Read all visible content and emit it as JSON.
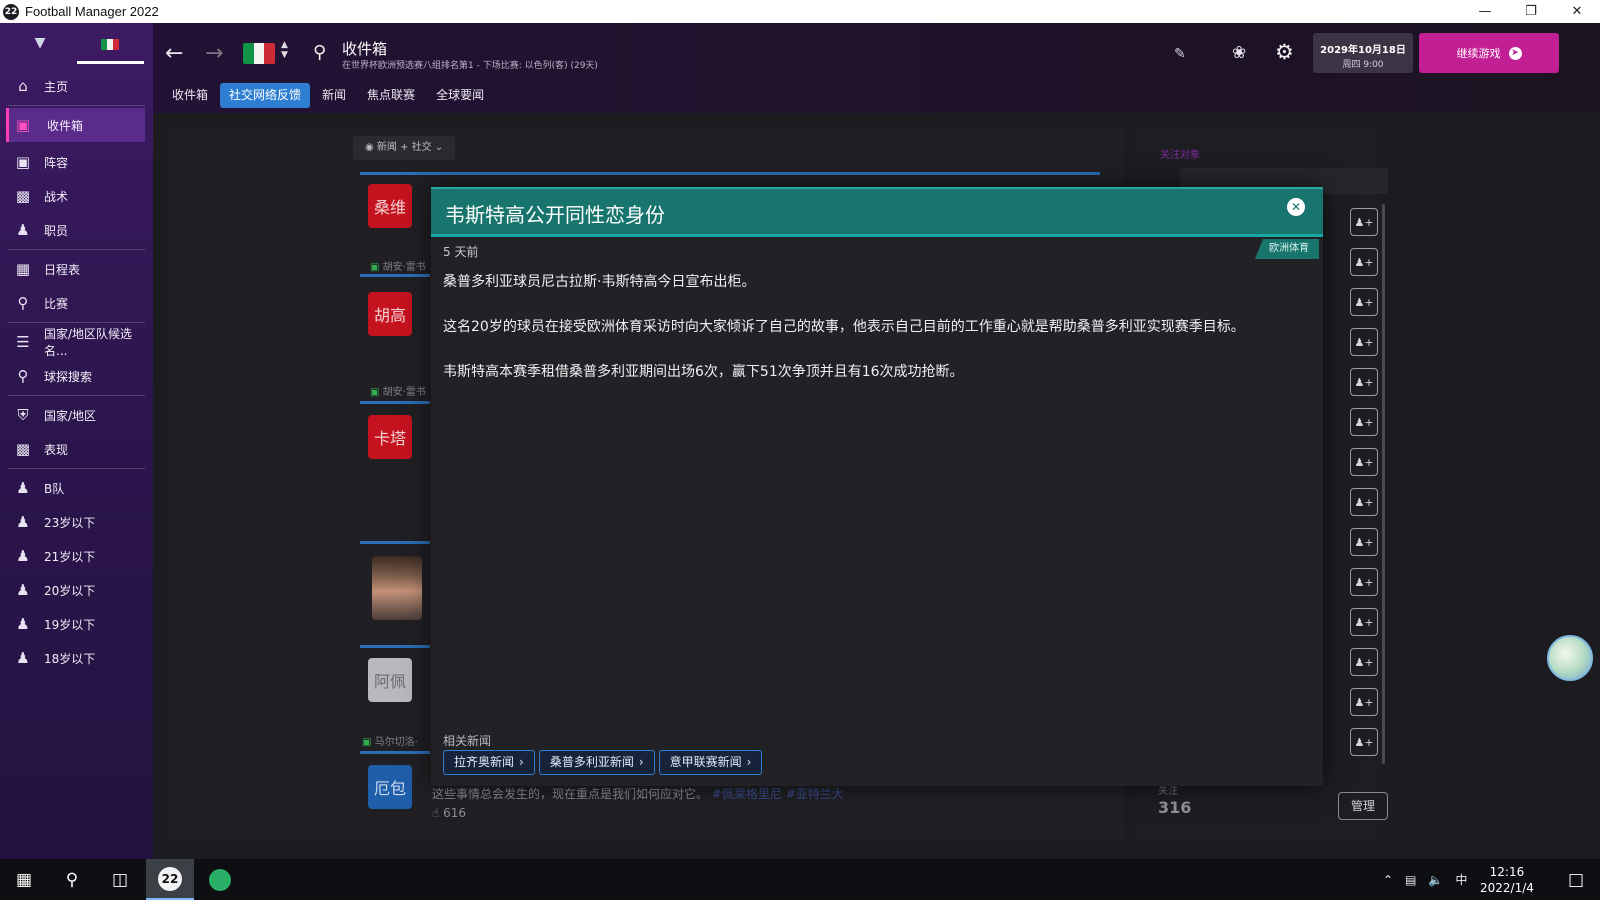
{
  "window": {
    "title": "Football Manager 2022",
    "app_icon": "22",
    "controls": [
      "minimize-icon",
      "restore-icon",
      "close-icon"
    ]
  },
  "colors": {
    "sidebar": "#3d1b63",
    "accent": "#c21f94",
    "tab_active": "#2e7fd1",
    "modal_header": "#17756d"
  },
  "sidebar": {
    "items": [
      {
        "label": "主页",
        "icon": "home-icon"
      },
      {
        "label": "收件箱",
        "icon": "inbox-icon",
        "active": true
      },
      {
        "label": "阵容",
        "icon": "squad-shirt-icon"
      },
      {
        "label": "战术",
        "icon": "tactics-board-icon"
      },
      {
        "label": "职员",
        "icon": "staff-icon"
      },
      {
        "label": "日程表",
        "icon": "calendar-icon"
      },
      {
        "label": "比赛",
        "icon": "trophy-icon"
      },
      {
        "label": "国家/地区队候选名...",
        "icon": "list-icon"
      },
      {
        "label": "球探搜索",
        "icon": "search-icon"
      },
      {
        "label": "国家/地区",
        "icon": "shield-icon"
      },
      {
        "label": "表现",
        "icon": "briefcase-icon"
      },
      {
        "label": "B队",
        "icon": "team-icon"
      },
      {
        "label": "23岁以下",
        "icon": "team-icon"
      },
      {
        "label": "21岁以下",
        "icon": "team-icon"
      },
      {
        "label": "20岁以下",
        "icon": "team-icon"
      },
      {
        "label": "19岁以下",
        "icon": "team-icon"
      },
      {
        "label": "18岁以下",
        "icon": "team-icon"
      }
    ]
  },
  "header": {
    "page_title": "收件箱",
    "subtitle": "在世界杯欧洲预选赛八组排名第1 - 下场比赛: 以色列(客) (29天)",
    "date_line1": "2029年10月18日",
    "date_line2": "周四 9:00",
    "continue_label": "继续游戏",
    "tabs": [
      {
        "label": "收件箱"
      },
      {
        "label": "社交网络反馈",
        "active": true
      },
      {
        "label": "新闻"
      },
      {
        "label": "焦点联赛"
      },
      {
        "label": "全球要闻"
      }
    ]
  },
  "feed": {
    "filter_label": "新闻 + 社交",
    "cards": [
      {
        "badge": "桑维",
        "author": "胡安·雷书"
      },
      {
        "badge": "胡高",
        "author": "胡安·雷书"
      },
      {
        "badge": "卡塔",
        "author": ""
      },
      {
        "badge": "阿佩",
        "author": "马尔切洛·"
      },
      {
        "badge": "厄包",
        "author": ""
      }
    ],
    "post_text": "这些事情总会发生的，现在重点是我们如何应对它。",
    "post_hashtags": "#佩莱格里尼 #亚特兰大",
    "post_likes": "616"
  },
  "follow": {
    "title": "关注对象",
    "search_placeholder": "",
    "count_label": "关注",
    "count": "316",
    "manage_label": "管理"
  },
  "modal": {
    "title": "韦斯特高公开同性恋身份",
    "time": "5 天前",
    "source": "欧洲体育",
    "paragraphs": [
      "桑普多利亚球员尼古拉斯·韦斯特高今日宣布出柜。",
      "这名20岁的球员在接受欧洲体育采访时向大家倾诉了自己的故事，他表示自己目前的工作重心就是帮助桑普多利亚实现赛季目标。",
      "韦斯特高本赛季租借桑普多利亚期间出场6次，赢下51次争顶并且有16次成功抢断。"
    ],
    "related_label": "相关新闻",
    "related": [
      "拉齐奥新闻",
      "桑普多利亚新闻",
      "意甲联赛新闻"
    ]
  },
  "taskbar": {
    "fm_label": "22",
    "ime": "中",
    "time": "12:16",
    "date": "2022/1/4"
  }
}
